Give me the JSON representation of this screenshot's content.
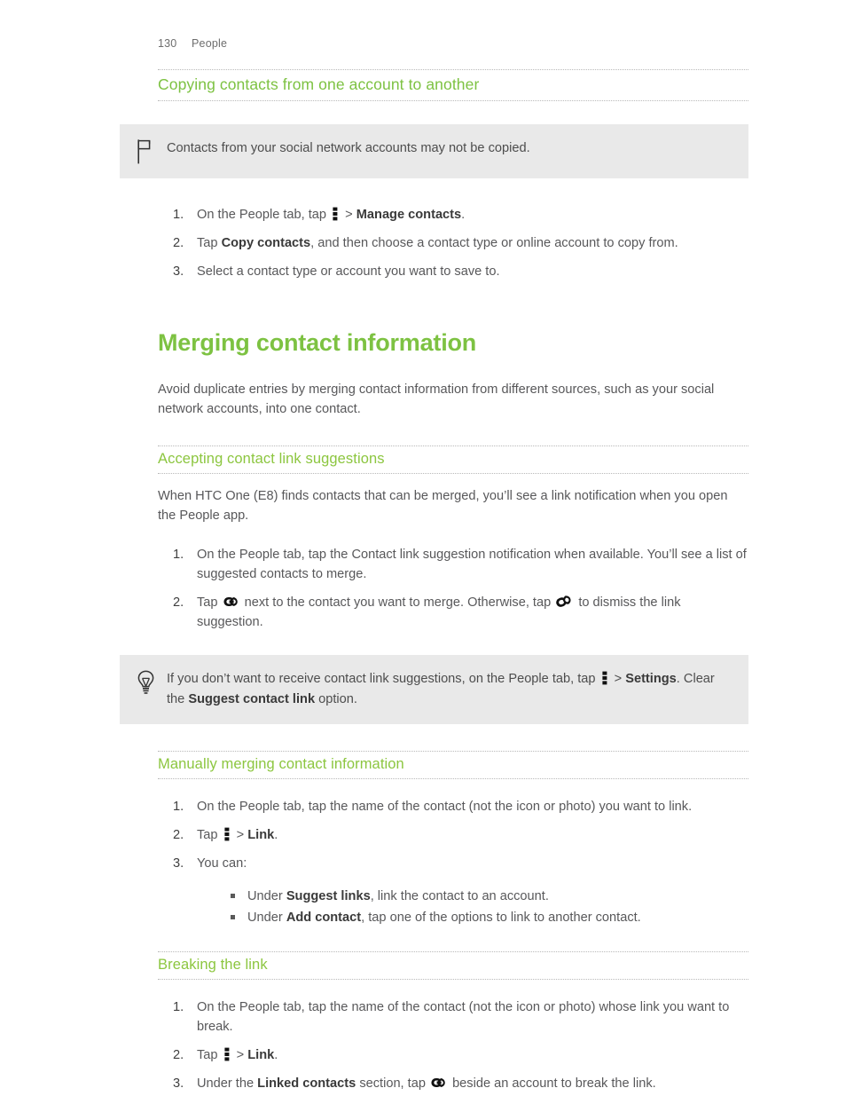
{
  "header": {
    "page_number": "130",
    "chapter": "People"
  },
  "colors": {
    "heading_green": "#7dc242",
    "subheading_green": "#8cc63f",
    "callout_background": "#e9e9e9",
    "body_text": "#58585a",
    "rule_dotted": "#b9b9b9"
  },
  "sections": {
    "copying": {
      "heading": "Copying contacts from one account to another",
      "note": {
        "icon": "flag-icon",
        "text": "Contacts from your social network accounts may not be copied."
      },
      "steps": [
        {
          "parts": [
            {
              "type": "text",
              "value": "On the People tab, tap "
            },
            {
              "type": "icon",
              "value": "overflow-menu-icon"
            },
            {
              "type": "text",
              "value": " > "
            },
            {
              "type": "bold",
              "value": "Manage contacts"
            },
            {
              "type": "text",
              "value": "."
            }
          ]
        },
        {
          "parts": [
            {
              "type": "text",
              "value": "Tap "
            },
            {
              "type": "bold",
              "value": "Copy contacts"
            },
            {
              "type": "text",
              "value": ", and then choose a contact type or online account to copy from."
            }
          ]
        },
        {
          "parts": [
            {
              "type": "text",
              "value": "Select a contact type or account you want to save to."
            }
          ]
        }
      ]
    },
    "merging": {
      "title": "Merging contact information",
      "intro": "Avoid duplicate entries by merging contact information from different sources, such as your social network accounts, into one contact.",
      "accepting": {
        "heading": "Accepting contact link suggestions",
        "intro": "When HTC One (E8) finds contacts that can be merged, you’ll see a link notification when you open the People app.",
        "steps": [
          {
            "parts": [
              {
                "type": "text",
                "value": "On the People tab, tap the Contact link suggestion notification when available. You’ll see a list of suggested contacts to merge."
              }
            ]
          },
          {
            "parts": [
              {
                "type": "text",
                "value": "Tap "
              },
              {
                "type": "icon",
                "value": "link-icon"
              },
              {
                "type": "text",
                "value": " next to the contact you want to merge. Otherwise, tap "
              },
              {
                "type": "icon",
                "value": "broken-link-icon"
              },
              {
                "type": "text",
                "value": " to dismiss the link suggestion."
              }
            ]
          }
        ],
        "tip": {
          "icon": "lightbulb-icon",
          "parts": [
            {
              "type": "text",
              "value": "If you don’t want to receive contact link suggestions, on the People tab, tap "
            },
            {
              "type": "icon",
              "value": "overflow-menu-icon"
            },
            {
              "type": "text",
              "value": " > "
            },
            {
              "type": "bold",
              "value": "Settings"
            },
            {
              "type": "text",
              "value": ". Clear the "
            },
            {
              "type": "bold",
              "value": "Suggest contact link"
            },
            {
              "type": "text",
              "value": " option."
            }
          ]
        }
      },
      "manual": {
        "heading": "Manually merging contact information",
        "steps": [
          {
            "parts": [
              {
                "type": "text",
                "value": "On the People tab, tap the name of the contact (not the icon or photo) you want to link."
              }
            ]
          },
          {
            "parts": [
              {
                "type": "text",
                "value": "Tap "
              },
              {
                "type": "icon",
                "value": "overflow-menu-icon"
              },
              {
                "type": "text",
                "value": " > "
              },
              {
                "type": "bold",
                "value": "Link"
              },
              {
                "type": "text",
                "value": "."
              }
            ]
          },
          {
            "parts": [
              {
                "type": "text",
                "value": "You can:"
              }
            ],
            "sub_items": [
              {
                "parts": [
                  {
                    "type": "text",
                    "value": "Under "
                  },
                  {
                    "type": "bold",
                    "value": "Suggest links"
                  },
                  {
                    "type": "text",
                    "value": ", link the contact to an account."
                  }
                ]
              },
              {
                "parts": [
                  {
                    "type": "text",
                    "value": "Under "
                  },
                  {
                    "type": "bold",
                    "value": "Add contact"
                  },
                  {
                    "type": "text",
                    "value": ", tap one of the options to link to another contact."
                  }
                ]
              }
            ]
          }
        ]
      },
      "breaking": {
        "heading": "Breaking the link",
        "steps": [
          {
            "parts": [
              {
                "type": "text",
                "value": "On the People tab, tap the name of the contact (not the icon or photo) whose link you want to break."
              }
            ]
          },
          {
            "parts": [
              {
                "type": "text",
                "value": "Tap "
              },
              {
                "type": "icon",
                "value": "overflow-menu-icon"
              },
              {
                "type": "text",
                "value": " > "
              },
              {
                "type": "bold",
                "value": "Link"
              },
              {
                "type": "text",
                "value": "."
              }
            ]
          },
          {
            "parts": [
              {
                "type": "text",
                "value": "Under the "
              },
              {
                "type": "bold",
                "value": "Linked contacts"
              },
              {
                "type": "text",
                "value": " section, tap "
              },
              {
                "type": "icon",
                "value": "link-icon"
              },
              {
                "type": "text",
                "value": " beside an account to break the link."
              }
            ]
          }
        ]
      }
    }
  }
}
